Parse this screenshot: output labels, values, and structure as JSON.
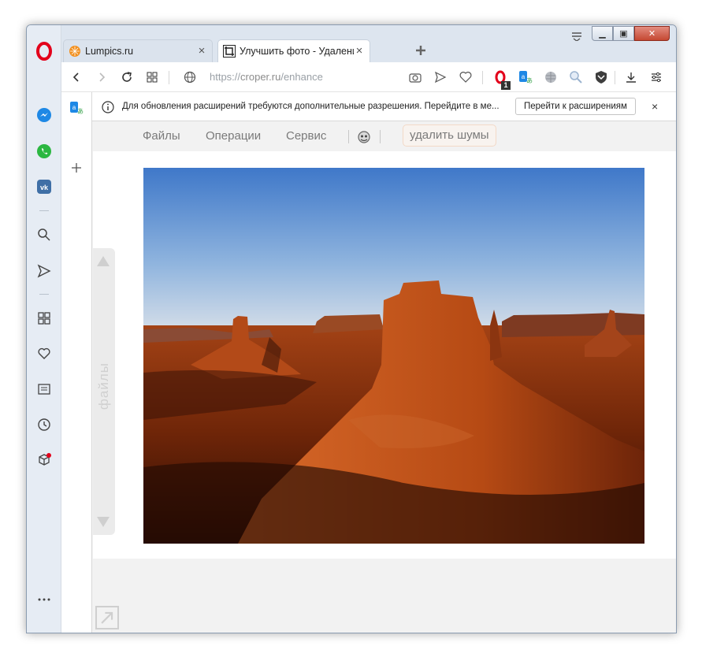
{
  "browser": {
    "tabs": [
      {
        "title": "Lumpics.ru",
        "active": false
      },
      {
        "title": "Улучшить фото - Удаление",
        "active": true
      }
    ],
    "address": {
      "scheme": "https://",
      "host": "croper.ru",
      "path": "/enhance"
    },
    "ext_badge_count": "1"
  },
  "notification": {
    "message": "Для обновления расширений требуются дополнительные разрешения. Перейдите в ме...",
    "button_label": "Перейти к расширениям",
    "close_label": "×"
  },
  "site_menu": {
    "items": [
      "Файлы",
      "Операции",
      "Сервис"
    ],
    "action_label": "удалить шумы"
  },
  "files_panel": {
    "label": "файлы"
  },
  "colors": {
    "opera_red": "#e3001b",
    "sidebar_bg": "#e6ecf4",
    "accent_border": "#f2d9c7"
  }
}
